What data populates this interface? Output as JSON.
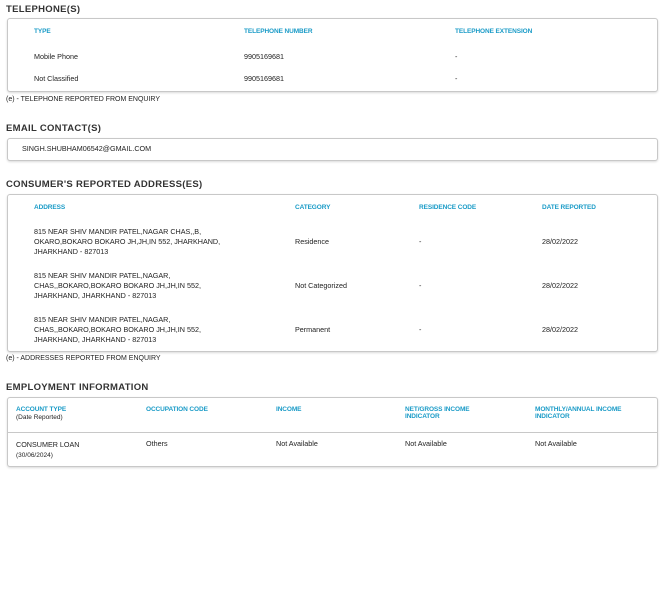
{
  "telephones": {
    "title": "TELEPHONE(S)",
    "headers": [
      "TYPE",
      "TELEPHONE NUMBER",
      "TELEPHONE EXTENSION"
    ],
    "rows": [
      [
        "Mobile Phone",
        "9905169681",
        "-"
      ],
      [
        "Not Classified",
        "9905169681",
        "-"
      ]
    ],
    "note": "(e) - TELEPHONE REPORTED FROM ENQUIRY"
  },
  "email": {
    "title": "EMAIL CONTACT(S)",
    "value": "SINGH.SHUBHAM06542@GMAIL.COM"
  },
  "addresses": {
    "title": "CONSUMER'S REPORTED ADDRESS(ES)",
    "headers": [
      "ADDRESS",
      "CATEGORY",
      "RESIDENCE CODE",
      "DATE REPORTED"
    ],
    "rows": [
      {
        "address": [
          "815 NEAR SHIV MANDIR PATEL,NAGAR CHAS,,B,",
          "OKARO,BOKARO BOKARO JH,JH,IN 552, JHARKHAND,",
          "JHARKHAND - 827013"
        ],
        "category": "Residence",
        "code": "-",
        "date": "28/02/2022"
      },
      {
        "address": [
          "815 NEAR SHIV MANDIR PATEL,NAGAR,",
          "CHAS,,BOKARO,BOKARO BOKARO JH,JH,IN 552,",
          "JHARKHAND, JHARKHAND - 827013"
        ],
        "category": "Not Categorized",
        "code": "-",
        "date": "28/02/2022"
      },
      {
        "address": [
          "815 NEAR SHIV MANDIR PATEL,NAGAR,",
          "CHAS,,BOKARO,BOKARO BOKARO JH,JH,IN 552,",
          "JHARKHAND, JHARKHAND - 827013"
        ],
        "category": "Permanent",
        "code": "-",
        "date": "28/02/2022"
      }
    ],
    "note": "(e) - ADDRESSES REPORTED FROM ENQUIRY"
  },
  "employment": {
    "title": "EMPLOYMENT INFORMATION",
    "headers": [
      "ACCOUNT TYPE",
      "OCCUPATION CODE",
      "INCOME",
      [
        "NET/GROSS INCOME",
        "INDICATOR"
      ],
      [
        "MONTHLY/ANNUAL INCOME",
        "INDICATOR"
      ]
    ],
    "header_sub": "(Date Reported)",
    "row": {
      "account_type": "CONSUMER LOAN",
      "date": "(30/06/2024)",
      "occupation": "Others",
      "income": "Not Available",
      "net_gross": "Not Available",
      "monthly_annual": "Not Available"
    }
  }
}
